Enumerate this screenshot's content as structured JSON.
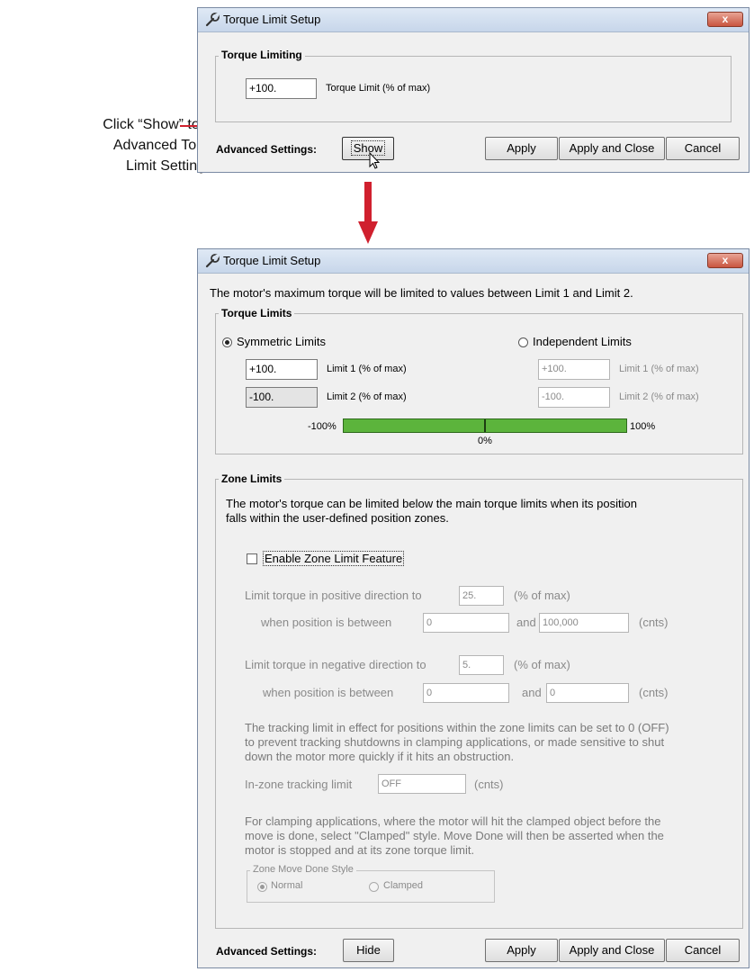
{
  "callout": {
    "line1": "Click “Show” to open",
    "line2": "Advanced Torque",
    "line3": "Limit Settings"
  },
  "colors": {
    "arrow": "#d0202e",
    "bar": "#5cb43c",
    "callout_line": "#d0202e"
  },
  "icons": {
    "title": "wrench-icon",
    "close": "close-icon",
    "cursor": "mouse-cursor-icon"
  },
  "top_dialog": {
    "title": "Torque Limit Setup",
    "close_label": "x",
    "group_label": "Torque Limiting",
    "torque_value": "+100.",
    "torque_label": "Torque Limit (% of max)",
    "advanced_label": "Advanced Settings:",
    "show_button": "Show",
    "apply_button": "Apply",
    "apply_close_button": "Apply and Close",
    "cancel_button": "Cancel"
  },
  "bottom_dialog": {
    "title": "Torque Limit Setup",
    "close_label": "x",
    "intro": "The motor's maximum torque will be limited to values between Limit 1 and Limit 2.",
    "torque_limits": {
      "label": "Torque Limits",
      "symmetric_label": "Symmetric Limits",
      "symmetric_selected": true,
      "independent_label": "Independent Limits",
      "sym_limit1_value": "+100.",
      "sym_limit1_label": "Limit 1 (% of max)",
      "sym_limit2_value": "-100.",
      "sym_limit2_label": "Limit 2 (% of max)",
      "ind_limit1_value": "+100.",
      "ind_limit1_label": "Limit 1 (% of max)",
      "ind_limit2_value": "-100.",
      "ind_limit2_label": "Limit 2 (% of max)",
      "bar_min_label": "-100%",
      "bar_max_label": "100%",
      "bar_mid_label": "0%"
    },
    "zone_limits": {
      "label": "Zone Limits",
      "description_line1": "The motor's torque can be limited below the main torque limits when its position",
      "description_line2": "falls within the user-defined position zones.",
      "enable_label": "Enable Zone Limit Feature",
      "enable_checked": false,
      "pos_limit_label": "Limit torque in positive direction to",
      "pos_limit_value": "25.",
      "pos_limit_unit": "(% of max)",
      "pos_between_label": "when position is between",
      "pos_from_value": "0",
      "pos_and_label": "and",
      "pos_to_value": "100,000",
      "pos_units": "(cnts)",
      "neg_limit_label": "Limit torque in negative direction to",
      "neg_limit_value": "5.",
      "neg_limit_unit": "(% of max)",
      "neg_between_label": "when position is between",
      "neg_from_value": "0",
      "neg_and_label": "and",
      "neg_to_value": "0",
      "neg_units": "(cnts)",
      "tracking_line1": "The tracking limit in effect for positions within the zone limits can be set to 0 (OFF)",
      "tracking_line2": "to prevent tracking shutdowns in clamping applications, or made sensitive to shut",
      "tracking_line3": "down the motor more quickly if it hits an obstruction.",
      "tracking_label": "In-zone tracking limit",
      "tracking_value": "OFF",
      "tracking_units": "(cnts)",
      "clamp_line1": "For clamping applications, where the motor will hit the clamped object before the",
      "clamp_line2": "move is done, select \"Clamped\" style. Move Done will then be asserted when the",
      "clamp_line3": "motor is stopped and at its zone torque limit.",
      "style_group_label": "Zone Move Done Style",
      "normal_label": "Normal",
      "normal_selected": true,
      "clamped_label": "Clamped"
    },
    "advanced_label": "Advanced Settings:",
    "hide_button": "Hide",
    "apply_button": "Apply",
    "apply_close_button": "Apply and Close",
    "cancel_button": "Cancel"
  }
}
